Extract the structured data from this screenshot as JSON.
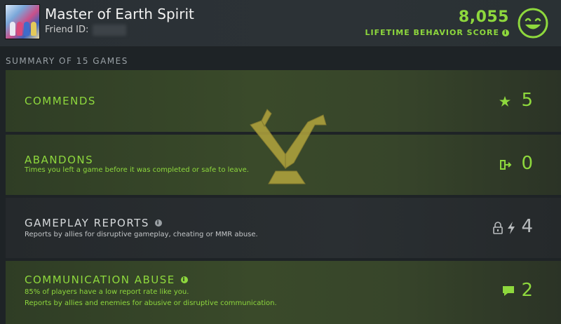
{
  "header": {
    "player_name": "Master of Earth Spirit",
    "friend_id_label": "Friend ID:",
    "score": "8,055",
    "score_label": "LIFETIME BEHAVIOR SCORE",
    "info_icon": "i"
  },
  "summary_label": "SUMMARY OF 15 GAMES",
  "rows": {
    "commends": {
      "title": "COMMENDS",
      "value": "5"
    },
    "abandons": {
      "title": "ABANDONS",
      "desc": "Times you left a game before it was completed or safe to leave.",
      "value": "0"
    },
    "reports": {
      "title": "GAMEPLAY REPORTS",
      "desc": "Reports by allies for disruptive gameplay, cheating or MMR abuse.",
      "value": "4"
    },
    "comm": {
      "title": "COMMUNICATION ABUSE",
      "desc1": "85% of players have a low report rate like you.",
      "desc2": "Reports by allies and enemies for abusive or disruptive communication.",
      "value": "2"
    }
  },
  "colors": {
    "accent": "#8ed83d",
    "background": "#1e2326",
    "emblem": "#b3a53d"
  },
  "icons": [
    "smiley-icon",
    "star-icon",
    "exit-door-icon",
    "lock-icon",
    "lightning-icon",
    "chat-icon",
    "info-icon"
  ]
}
